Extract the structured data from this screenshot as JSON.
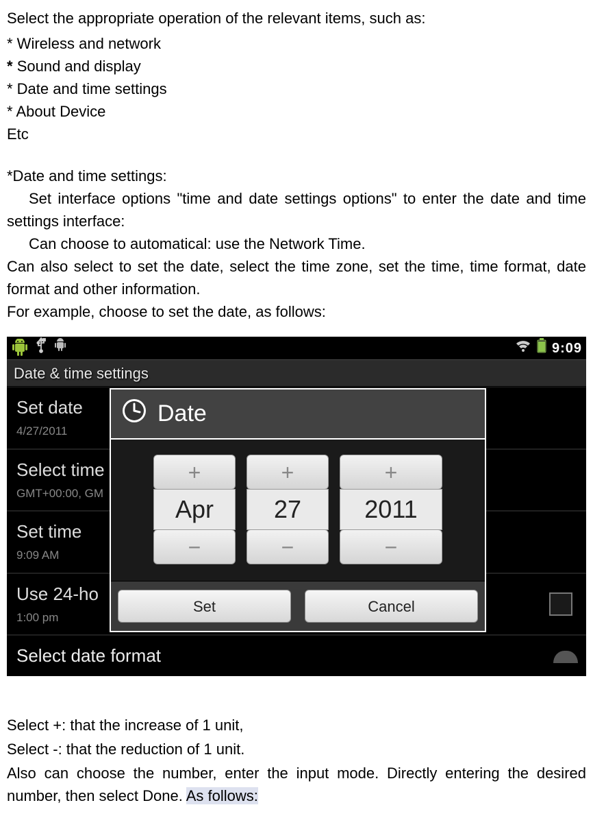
{
  "intro": {
    "line1": "Select the appropriate operation of the relevant items, such as:",
    "b1": "* Wireless and network",
    "b2_prefix": "* ",
    "b2_text": "Sound and display",
    "b3": "* Date and time settings",
    "b4": "* About Device",
    "b5": "Etc"
  },
  "section": {
    "heading": "*Date and time settings:",
    "p1": "Set interface options \"time and date settings options\" to enter the date and time settings interface:",
    "p2": "Can choose to automatical: use the Network Time.",
    "p3": "Can also select to set the date, select the time zone, set the time, time format, date format and other information.",
    "p4": "For example, choose to set the date, as follows:"
  },
  "screenshot": {
    "status": {
      "time": "9:09"
    },
    "titlebar": "Date & time settings",
    "rows": {
      "r1": {
        "title": "Set date",
        "sub": "4/27/2011"
      },
      "r2": {
        "title": "Select time",
        "sub": "GMT+00:00, GM"
      },
      "r3": {
        "title": "Set time",
        "sub": "9:09 AM"
      },
      "r4": {
        "title": "Use 24-ho",
        "sub": "1:00 pm"
      },
      "r5": {
        "title": "Select date format"
      }
    },
    "dialog": {
      "title": "Date",
      "month": "Apr",
      "day": "27",
      "year": "2011",
      "plus": "+",
      "minus": "−",
      "set": "Set",
      "cancel": "Cancel"
    }
  },
  "follow": {
    "l1": "Select +: that the increase of 1 unit,",
    "l2": "Select -: that the reduction of 1 unit.",
    "l3a": "Also can choose the number, enter the input mode. Directly entering the desired number, then select Done. ",
    "l3b": "As follows:"
  }
}
